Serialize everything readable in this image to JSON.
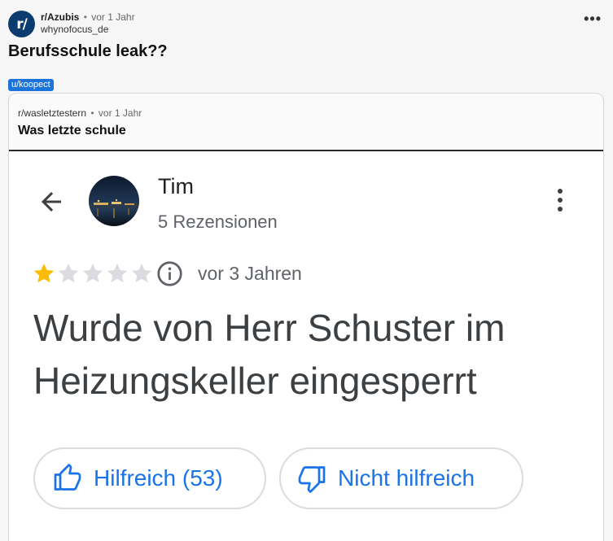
{
  "post": {
    "subreddit": "r/Azubis",
    "separator": "•",
    "time": "vor 1 Jahr",
    "author": "whynofocus_de",
    "title": "Berufsschule leak??",
    "flair": "u/koopect",
    "avatar_text": "r/",
    "more_label": "•••"
  },
  "crosspost": {
    "subreddit": "r/wasletztestern",
    "separator": "•",
    "time": "vor 1 Jahr",
    "title": "Was letzte schule"
  },
  "review": {
    "reviewer_name": "Tim",
    "review_count": "5 Rezensionen",
    "rating": 1,
    "rating_max": 5,
    "time": "vor 3 Jahren",
    "text": "Wurde von Herr Schuster im Heizungskeller eingesperrt",
    "helpful_label": "Hilfreich (53)",
    "unhelpful_label": "Nicht hilfreich"
  },
  "colors": {
    "subreddit_icon": "#0b3b6f",
    "flair_bg": "#1c73d9",
    "star_filled": "#fbbc04",
    "star_empty": "#dadce0",
    "link_blue": "#1a73e8"
  },
  "icons": [
    "back-arrow-icon",
    "kebab-menu-icon",
    "star-icon",
    "info-icon",
    "thumbs-up-icon",
    "thumbs-down-icon"
  ]
}
